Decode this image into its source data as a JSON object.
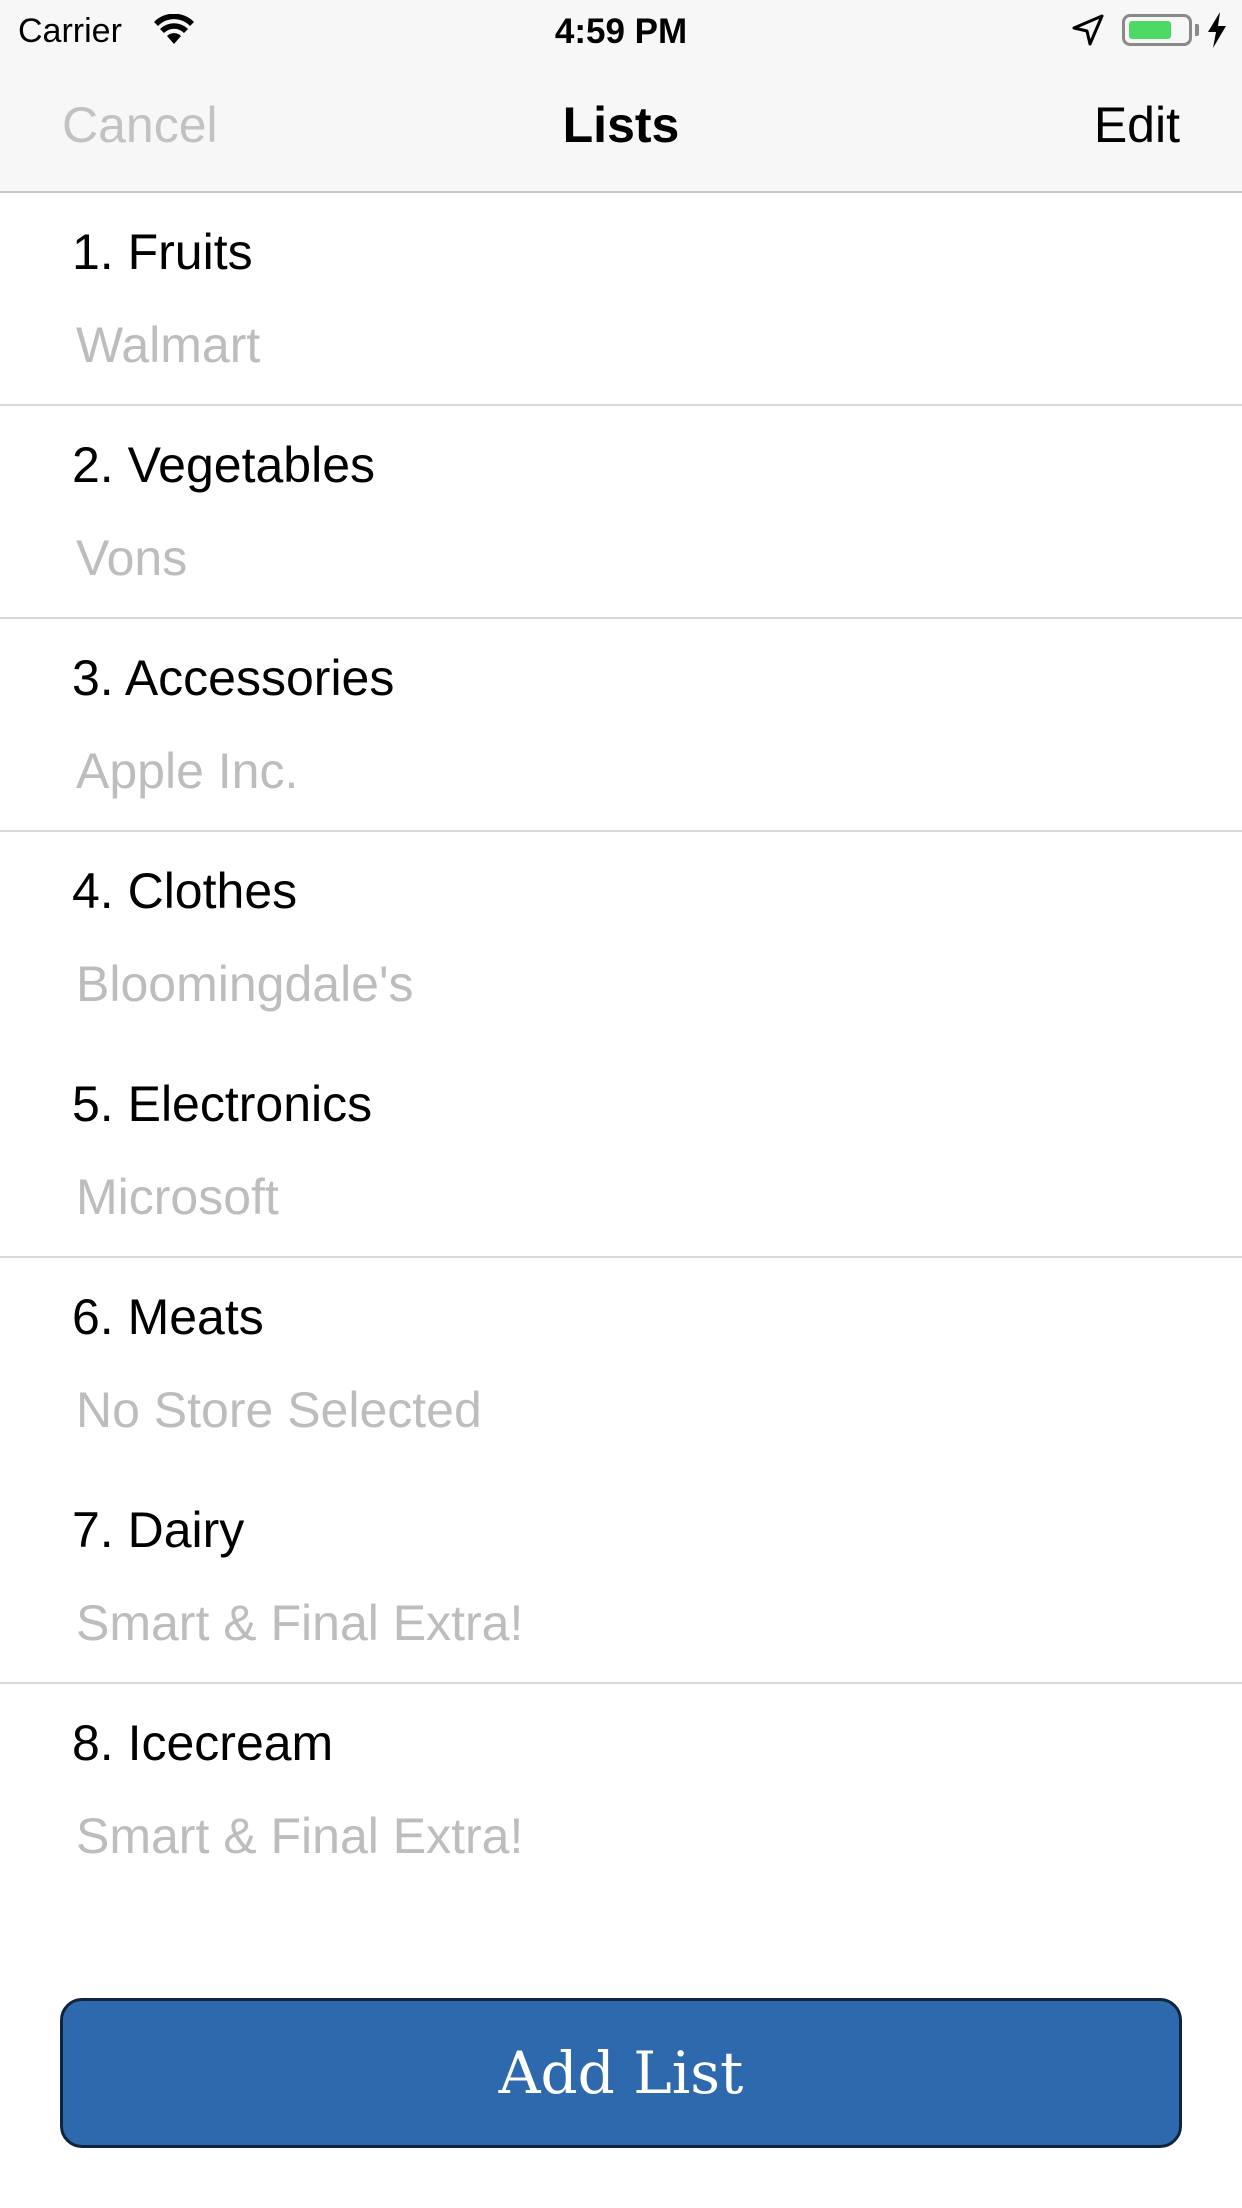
{
  "status_bar": {
    "carrier": "Carrier",
    "time": "4:59 PM",
    "battery_level": 0.75,
    "battery_color": "#4cd964"
  },
  "nav_bar": {
    "cancel_label": "Cancel",
    "title": "Lists",
    "edit_label": "Edit"
  },
  "lists": [
    {
      "name": "1. Fruits",
      "store": "Walmart",
      "separator": true
    },
    {
      "name": "2. Vegetables",
      "store": "Vons",
      "separator": true
    },
    {
      "name": "3. Accessories",
      "store": "Apple Inc.",
      "separator": true
    },
    {
      "name": "4. Clothes",
      "store": "Bloomingdale's",
      "separator": false
    },
    {
      "name": "5. Electronics",
      "store": "Microsoft",
      "separator": true
    },
    {
      "name": "6. Meats",
      "store": "No Store Selected",
      "separator": false
    },
    {
      "name": "7. Dairy",
      "store": "Smart & Final Extra!",
      "separator": true
    },
    {
      "name": "8. Icecream",
      "store": "Smart & Final Extra!",
      "separator": false
    }
  ],
  "add_button": {
    "label": "Add List",
    "color": "#2f69ad"
  }
}
